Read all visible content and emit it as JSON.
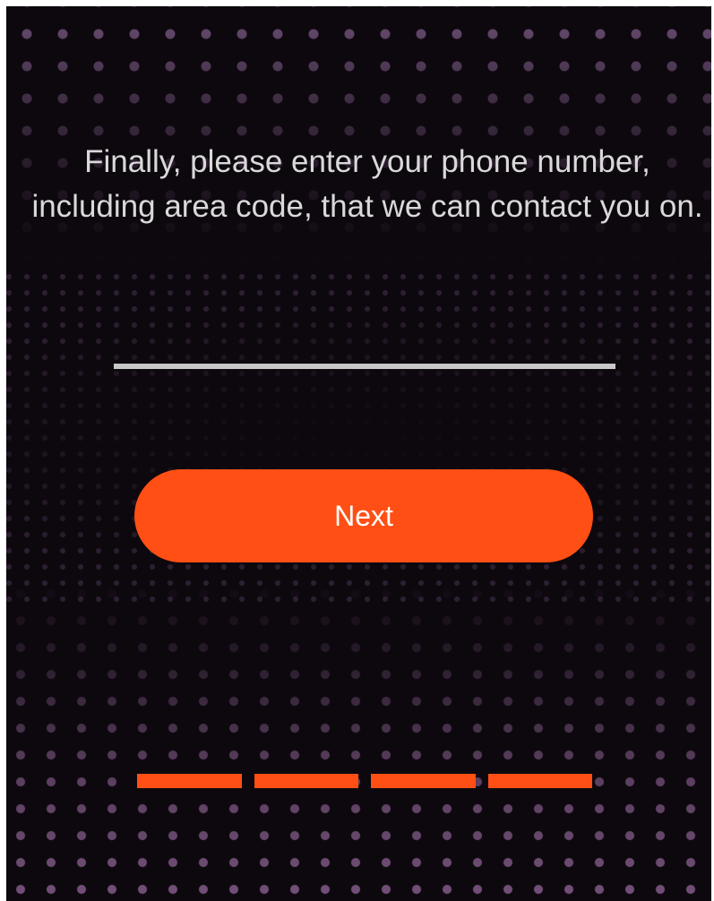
{
  "screen": {
    "prompt_text": "Finally, please enter your phone number, including area code, that we can contact you on.",
    "phone_input": {
      "value": "",
      "placeholder": ""
    },
    "next_button_label": "Next",
    "progress": {
      "total_steps": 4,
      "completed_steps": 4
    }
  },
  "colors": {
    "accent": "#ff4f14",
    "background": "#0d080e",
    "text": "#d9d9d9",
    "input_underline": "#c8c8c8"
  },
  "icons": []
}
